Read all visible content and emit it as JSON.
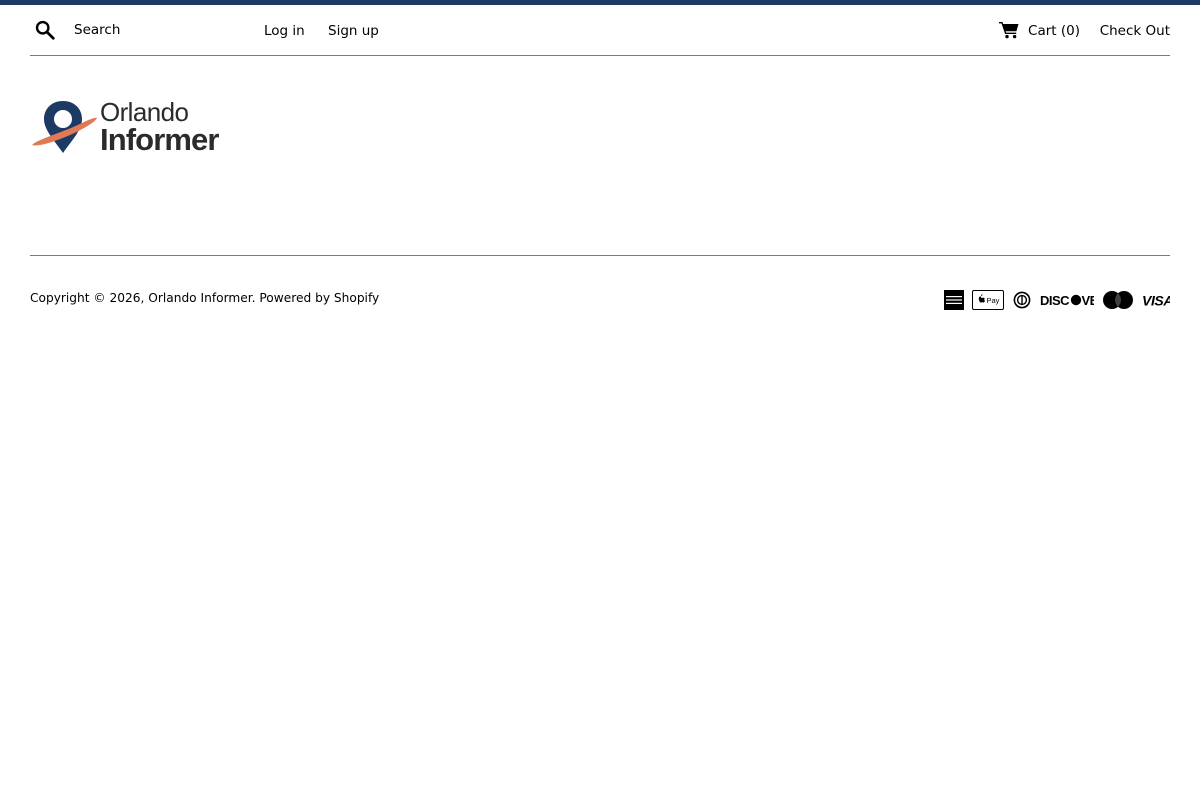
{
  "colors": {
    "accent_bar": "#1c3a63",
    "divider": "#3a8fb7",
    "logo_navy": "#1c3a63",
    "logo_orange": "#e07a55",
    "logo_text": "#2b2b2b"
  },
  "header": {
    "search": {
      "icon": "search-icon",
      "placeholder": "Search",
      "value": ""
    },
    "login_label": "Log in",
    "signup_label": "Sign up",
    "cart": {
      "icon": "cart-icon",
      "label": "Cart (0)"
    },
    "checkout_label": "Check Out"
  },
  "logo": {
    "icon": "location-pin-icon",
    "line1": "Orlando",
    "line2": "Informer"
  },
  "footer": {
    "copyright_prefix": "Copyright © 2026, ",
    "store_link": "Orlando Informer",
    "separator": ". ",
    "powered_by": "Powered by Shopify",
    "payment_icons": [
      "american-express-icon",
      "apple-pay-icon",
      "diners-club-icon",
      "discover-icon",
      "mastercard-icon",
      "visa-icon"
    ]
  }
}
